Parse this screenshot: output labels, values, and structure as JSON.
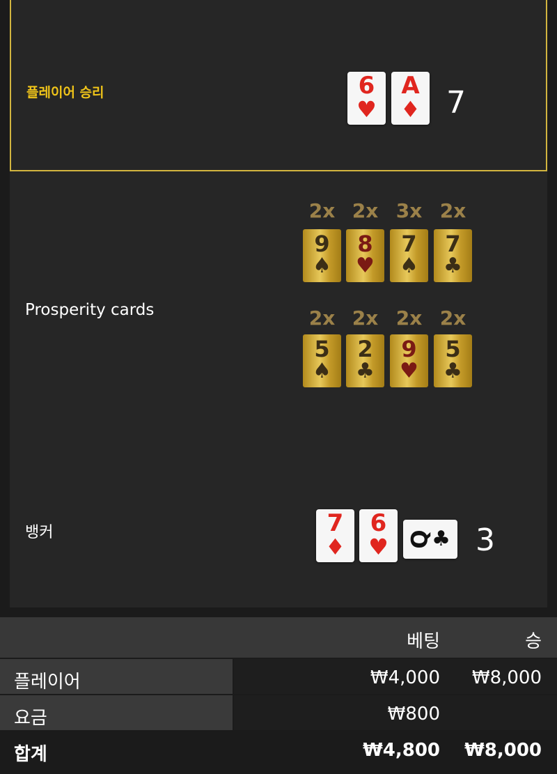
{
  "player": {
    "label": "플레이어 승리",
    "cards": [
      {
        "rank": "6",
        "suit": "♥",
        "color": "red"
      },
      {
        "rank": "A",
        "suit": "♦",
        "color": "red"
      }
    ],
    "total": "7"
  },
  "prosperity": {
    "label": "Prosperity cards",
    "cards": [
      {
        "multiplier": "2x",
        "rank": "9",
        "suit": "♠",
        "color": "black"
      },
      {
        "multiplier": "2x",
        "rank": "8",
        "suit": "♥",
        "color": "red"
      },
      {
        "multiplier": "3x",
        "rank": "7",
        "suit": "♠",
        "color": "black"
      },
      {
        "multiplier": "2x",
        "rank": "7",
        "suit": "♣",
        "color": "black"
      },
      {
        "multiplier": "2x",
        "rank": "5",
        "suit": "♠",
        "color": "black"
      },
      {
        "multiplier": "2x",
        "rank": "2",
        "suit": "♣",
        "color": "black"
      },
      {
        "multiplier": "2x",
        "rank": "9",
        "suit": "♥",
        "color": "red"
      },
      {
        "multiplier": "2x",
        "rank": "5",
        "suit": "♣",
        "color": "black"
      }
    ]
  },
  "banker": {
    "label": "뱅커",
    "cards": [
      {
        "rank": "7",
        "suit": "♦",
        "color": "red"
      },
      {
        "rank": "6",
        "suit": "♥",
        "color": "red"
      },
      {
        "rank": "Q",
        "suit": "♣",
        "color": "black"
      }
    ],
    "total": "3"
  },
  "summary": {
    "headers": {
      "bet": "베팅",
      "win": "승"
    },
    "rows": [
      {
        "name": "플레이어",
        "bet": "₩4,000",
        "win": "₩8,000"
      },
      {
        "name": "요금",
        "bet": "₩800",
        "win": ""
      }
    ],
    "total": {
      "name": "합계",
      "bet": "₩4,800",
      "win": "₩8,000"
    }
  },
  "colors": {
    "accent": "#f0c419",
    "panel": "#262626",
    "background": "#1b1b1b"
  }
}
